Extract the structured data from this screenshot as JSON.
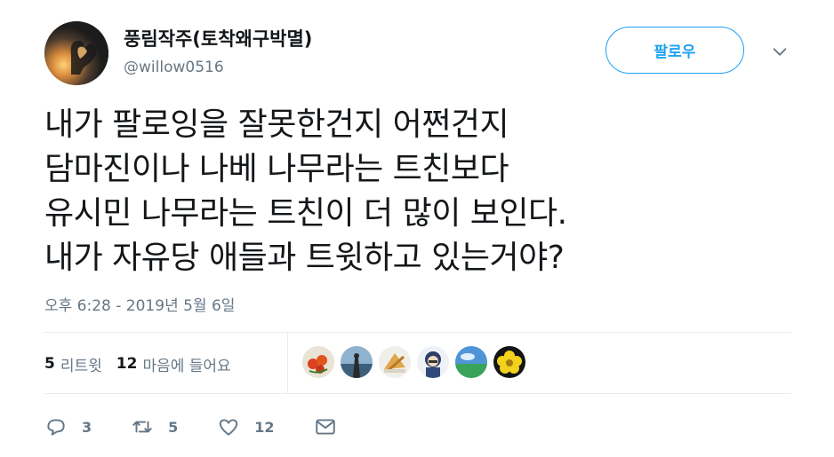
{
  "user": {
    "display_name": "풍림작주(토착왜구박멸)",
    "handle": "@willow0516"
  },
  "follow_button": {
    "label": "팔로우"
  },
  "tweet": {
    "lines": [
      "내가 팔로잉을 잘못한건지 어쩐건지",
      "담마진이나 나베 나무라는 트친보다",
      "유시민 나무라는 트친이 더 많이 보인다.",
      "내가 자유당 애들과 트윗하고 있는거야?"
    ],
    "timestamp": "오후 6:28 - 2019년 5월 6일"
  },
  "stats": {
    "retweets_count": "5",
    "retweets_label": "리트윗",
    "likes_count": "12",
    "likes_label": "마음에 들어요"
  },
  "likers": [
    {
      "name": "liker-avatar-1"
    },
    {
      "name": "liker-avatar-2"
    },
    {
      "name": "liker-avatar-3"
    },
    {
      "name": "liker-avatar-4"
    },
    {
      "name": "liker-avatar-5"
    },
    {
      "name": "liker-avatar-6"
    }
  ],
  "actions": {
    "reply_count": "3",
    "retweet_count": "5",
    "like_count": "12"
  },
  "colors": {
    "accent": "#1da1f2",
    "muted": "#657786",
    "text": "#14171a",
    "border": "#e6ecf0"
  },
  "icons": [
    "chevron-down-icon",
    "reply-icon",
    "retweet-icon",
    "heart-icon",
    "message-icon"
  ]
}
